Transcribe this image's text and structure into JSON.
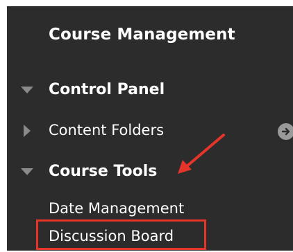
{
  "sidebar": {
    "title": "Course Management",
    "items": [
      {
        "label": "Control Panel"
      },
      {
        "label": "Content Folders"
      },
      {
        "label": "Course Tools"
      },
      {
        "label": "Date Management"
      },
      {
        "label": "Discussion Board"
      }
    ]
  },
  "colors": {
    "panel_bg": "#2c2c2c",
    "text": "#ffffff",
    "triangle": "#8a8a8a",
    "annotation_red": "#e5352b"
  },
  "icons": {
    "expanded": "triangle-down-icon",
    "collapsed": "triangle-right-icon",
    "forward": "circle-arrow-right-icon",
    "annotation_arrow": "red-arrow-icon"
  }
}
